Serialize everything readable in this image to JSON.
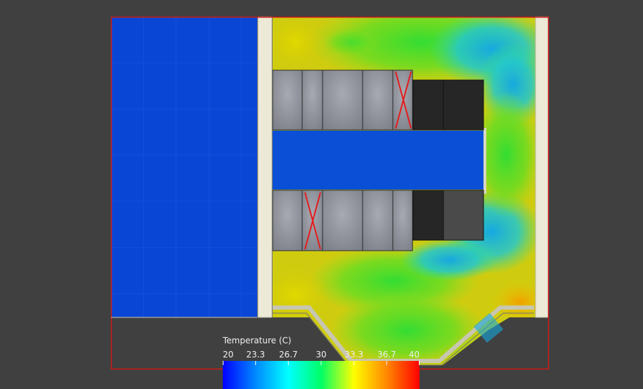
{
  "legend": {
    "title": "Temperature (C)",
    "ticks": [
      "20",
      "23.3",
      "26.7",
      "30",
      "33.3",
      "36.7",
      "40"
    ],
    "colors": [
      "#0000ff",
      "#0088ff",
      "#00ffff",
      "#00ff66",
      "#ffff00",
      "#ff8800",
      "#ff0000"
    ]
  },
  "scene": {
    "colors": {
      "background": "#404040",
      "border": "#d01818",
      "cold_region": "#0a46d6",
      "wall": "#ece9d6",
      "rack_light": "#8a8d96",
      "rack_dark": "#262626",
      "rack_mid": "#4a4a4a",
      "blocked_mark": "#e41c1c"
    }
  }
}
